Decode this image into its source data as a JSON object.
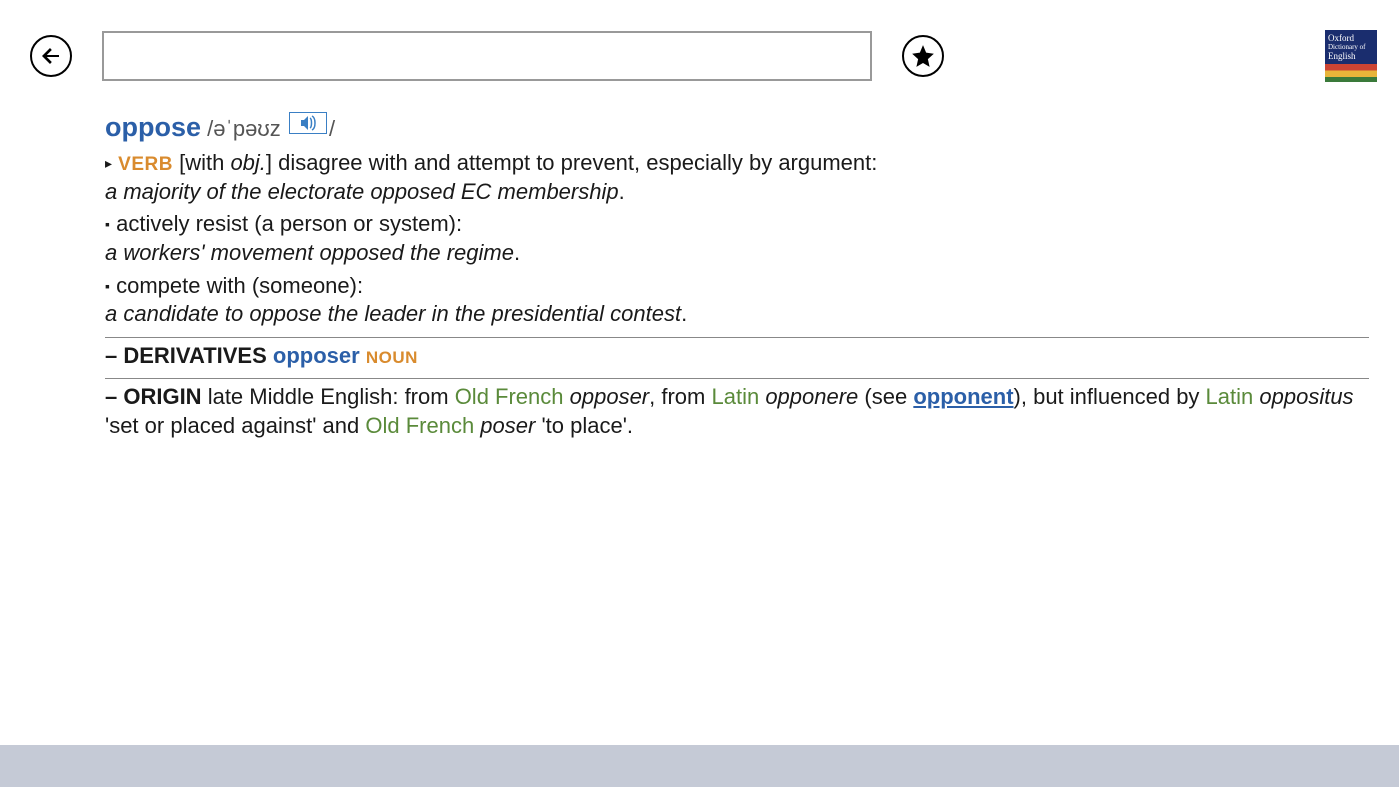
{
  "logo": {
    "line1": "Oxford",
    "line2": "Dictionary of",
    "line3": "English"
  },
  "entry": {
    "headword": "oppose",
    "pron_open": "/",
    "pronunciation": "əˈpəʊz",
    "pron_close": "/",
    "pos": "VERB",
    "gram_open": "[with ",
    "gram_obj": "obj.",
    "gram_close": "] ",
    "def1": "disagree with and attempt to prevent, especially by argument:",
    "ex1": "a majority of the electorate opposed EC membership",
    "def2": "actively resist (a person or system):",
    "ex2": "a workers' movement opposed the regime",
    "def3": "compete with (someone):",
    "ex3": "a candidate to oppose the leader in the presidential contest"
  },
  "derivatives": {
    "label": "– DERIVATIVES",
    "word": "opposer",
    "pos": "NOUN"
  },
  "origin": {
    "label": "– ORIGIN",
    "t1": " late Middle English: from ",
    "lang1": "Old French",
    "w1": " opposer",
    "t2": ", from ",
    "lang2": "Latin",
    "w2": " opponere",
    "t3": " (see ",
    "link": "opponent",
    "t4": "), but influenced by ",
    "lang3": "Latin",
    "w3": " oppositus",
    "t5": " 'set or placed against' and ",
    "lang4": "Old French",
    "w4": " poser",
    "t6": " 'to place'."
  }
}
